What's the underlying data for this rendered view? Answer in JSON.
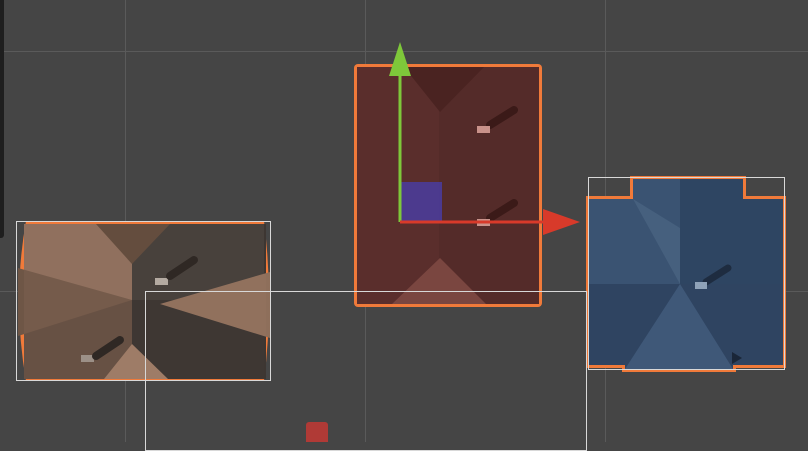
{
  "scene_view": {
    "sprites": [
      {
        "id": "left-room",
        "tint": "#9b7b66",
        "state": "selected"
      },
      {
        "id": "center-room",
        "tint": "#6a2f2c",
        "state": "active"
      },
      {
        "id": "right-room",
        "tint": "#3e5a78",
        "state": "selected"
      }
    ],
    "selection_color": "#f07a3a",
    "move_gizmo": {
      "x_axis_color": "#d83a2a",
      "y_axis_color": "#7ec83a",
      "plane_handle_color": "#4a3ca0",
      "icons": [
        "move-arrow-x-icon",
        "move-arrow-y-icon",
        "plane-handle-icon"
      ]
    }
  }
}
